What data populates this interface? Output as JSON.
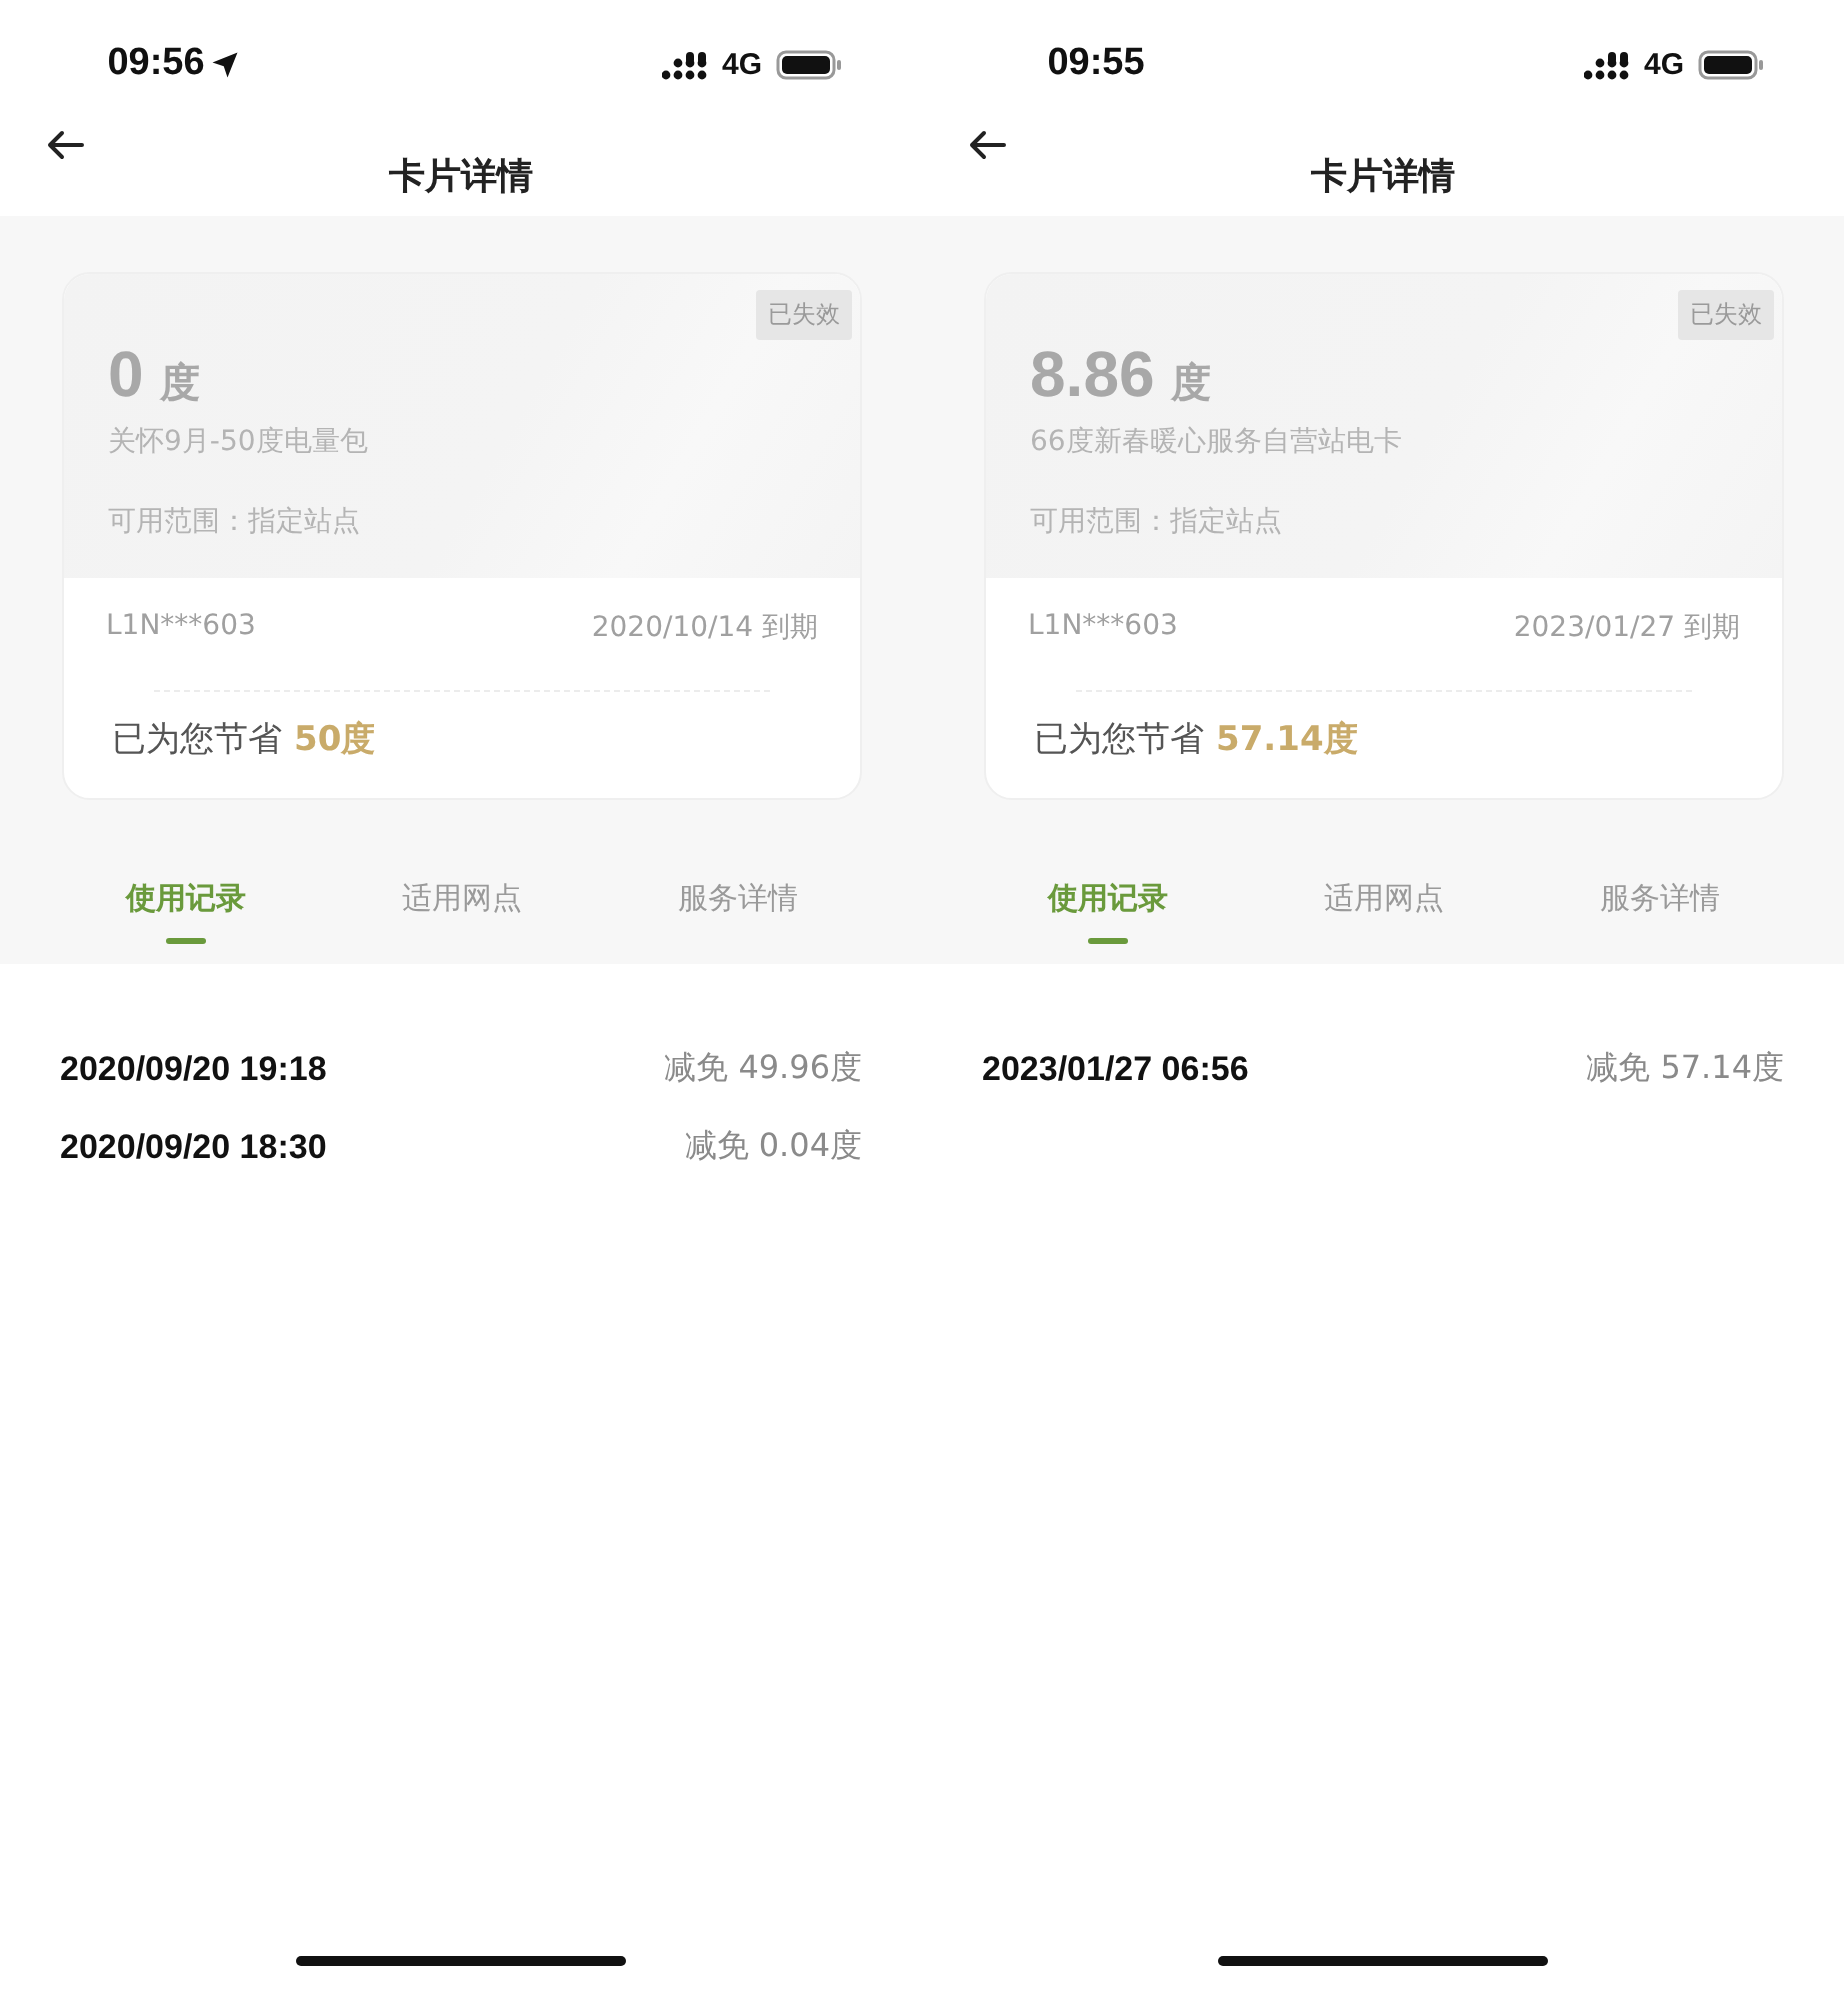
{
  "screens": [
    {
      "status_bar": {
        "time": "09:56",
        "location": true,
        "network": "4G"
      },
      "title": "卡片详情",
      "card": {
        "amount": "0",
        "unit": "度",
        "name": "关怀9月-50度电量包",
        "scope": "可用范围：指定站点",
        "status": "已失效",
        "card_no": "L1N***603",
        "expiry": "2020/10/14 到期",
        "saved_label": "已为您节省",
        "saved_value": "50度"
      },
      "tabs": [
        {
          "label": "使用记录",
          "selected": true
        },
        {
          "label": "适用网点",
          "selected": false
        },
        {
          "label": "服务详情",
          "selected": false
        }
      ],
      "records": [
        {
          "time": "2020/09/20 19:18",
          "amount": "减免 49.96度"
        },
        {
          "time": "2020/09/20 18:30",
          "amount": "减免 0.04度"
        }
      ]
    },
    {
      "status_bar": {
        "time": "09:55",
        "location": false,
        "network": "4G"
      },
      "title": "卡片详情",
      "card": {
        "amount": "8.86",
        "unit": "度",
        "name": "66度新春暖心服务自营站电卡",
        "scope": "可用范围：指定站点",
        "status": "已失效",
        "card_no": "L1N***603",
        "expiry": "2023/01/27 到期",
        "saved_label": "已为您节省",
        "saved_value": "57.14度"
      },
      "tabs": [
        {
          "label": "使用记录",
          "selected": true
        },
        {
          "label": "适用网点",
          "selected": false
        },
        {
          "label": "服务详情",
          "selected": false
        }
      ],
      "records": [
        {
          "time": "2023/01/27 06:56",
          "amount": "减免 57.14度"
        }
      ]
    }
  ]
}
